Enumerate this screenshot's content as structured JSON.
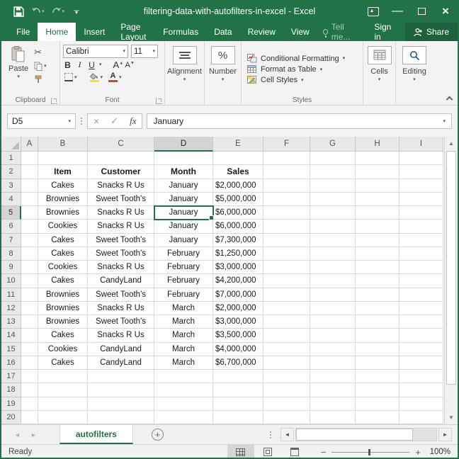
{
  "window": {
    "title": "filtering-data-with-autofilters-in-excel - Excel"
  },
  "tabs": [
    {
      "label": "File",
      "active": false
    },
    {
      "label": "Home",
      "active": true
    },
    {
      "label": "Insert",
      "active": false
    },
    {
      "label": "Page Layout",
      "active": false
    },
    {
      "label": "Formulas",
      "active": false
    },
    {
      "label": "Data",
      "active": false
    },
    {
      "label": "Review",
      "active": false
    },
    {
      "label": "View",
      "active": false
    }
  ],
  "tellme_label": "Tell me...",
  "signin_label": "Sign in",
  "share_label": "Share",
  "ribbon": {
    "clipboard": {
      "label": "Clipboard",
      "paste_label": "Paste"
    },
    "font": {
      "label": "Font",
      "font_name": "Calibri",
      "font_size": "11",
      "bold": "B",
      "italic": "I",
      "underline": "U",
      "grow_font": "A",
      "shrink_font": "A",
      "font_color_letter": "A",
      "highlight_color": "#ffe400",
      "font_color": "#e03c31"
    },
    "alignment": {
      "label": "Alignment"
    },
    "number": {
      "label": "Number",
      "glyph": "%"
    },
    "styles": {
      "label": "Styles",
      "items": [
        "Conditional Formatting",
        "Format as Table",
        "Cell Styles"
      ]
    },
    "cells": {
      "label": "Cells"
    },
    "editing": {
      "label": "Editing"
    }
  },
  "formula_bar": {
    "name_box": "D5",
    "formula": "January",
    "fx": "fx",
    "cancel": "×",
    "enter": "✓"
  },
  "grid": {
    "row_header_width": 28,
    "columns": [
      {
        "letter": "A",
        "width": 24
      },
      {
        "letter": "B",
        "width": 70
      },
      {
        "letter": "C",
        "width": 94
      },
      {
        "letter": "D",
        "width": 83
      },
      {
        "letter": "E",
        "width": 71
      },
      {
        "letter": "F",
        "width": 66
      },
      {
        "letter": "G",
        "width": 64
      },
      {
        "letter": "H",
        "width": 62
      },
      {
        "letter": "I",
        "width": 62
      }
    ],
    "visible_rows": 20,
    "selected_cell": {
      "col": "D",
      "row": 5
    },
    "header_row": {
      "row": 2,
      "cells": {
        "B": "Item",
        "C": "Customer",
        "D": "Month",
        "E": "Sales"
      }
    },
    "data_rows": [
      {
        "row": 3,
        "item": "Cakes",
        "customer": "Snacks R Us",
        "month": "January",
        "sales": "$2,000,000"
      },
      {
        "row": 4,
        "item": "Brownies",
        "customer": "Sweet Tooth's",
        "month": "January",
        "sales": "$5,000,000"
      },
      {
        "row": 5,
        "item": "Brownies",
        "customer": "Snacks R Us",
        "month": "January",
        "sales": "$6,000,000"
      },
      {
        "row": 6,
        "item": "Cookies",
        "customer": "Snacks R Us",
        "month": "January",
        "sales": "$6,000,000"
      },
      {
        "row": 7,
        "item": "Cakes",
        "customer": "Sweet Tooth's",
        "month": "January",
        "sales": "$7,300,000"
      },
      {
        "row": 8,
        "item": "Cakes",
        "customer": "Sweet Tooth's",
        "month": "February",
        "sales": "$1,250,000"
      },
      {
        "row": 9,
        "item": "Cookies",
        "customer": "Snacks R Us",
        "month": "February",
        "sales": "$3,000,000"
      },
      {
        "row": 10,
        "item": "Cakes",
        "customer": "CandyLand",
        "month": "February",
        "sales": "$4,200,000"
      },
      {
        "row": 11,
        "item": "Brownies",
        "customer": "Sweet Tooth's",
        "month": "February",
        "sales": "$7,000,000"
      },
      {
        "row": 12,
        "item": "Brownies",
        "customer": "Snacks R Us",
        "month": "March",
        "sales": "$2,000,000"
      },
      {
        "row": 13,
        "item": "Brownies",
        "customer": "Sweet Tooth's",
        "month": "March",
        "sales": "$3,000,000"
      },
      {
        "row": 14,
        "item": "Cakes",
        "customer": "Snacks R Us",
        "month": "March",
        "sales": "$3,500,000"
      },
      {
        "row": 15,
        "item": "Cookies",
        "customer": "CandyLand",
        "month": "March",
        "sales": "$4,000,000"
      },
      {
        "row": 16,
        "item": "Cakes",
        "customer": "CandyLand",
        "month": "March",
        "sales": "$6,700,000"
      }
    ]
  },
  "sheet_bar": {
    "active_tab": "autofilters",
    "add_label": "+"
  },
  "status_bar": {
    "status": "Ready",
    "zoom": "100%"
  },
  "colors": {
    "excel_green": "#217346",
    "selection_border": "#217346",
    "highlight_yellow": "#ffe400",
    "font_color_red": "#e03c31"
  }
}
